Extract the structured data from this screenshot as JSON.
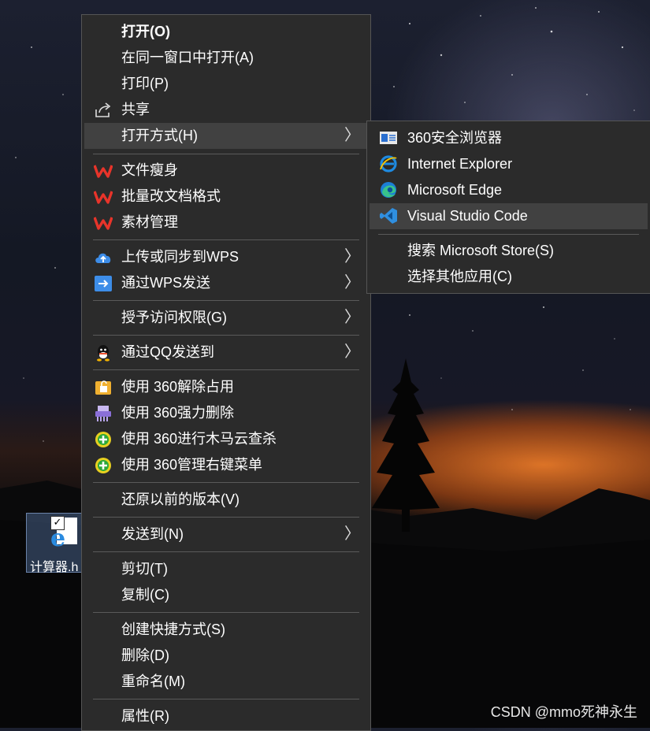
{
  "desktop": {
    "icon_label": "计算器.h",
    "icon_name": "html-file-icon"
  },
  "main_menu": {
    "items": [
      {
        "label": "打开(O)",
        "icon": "none"
      },
      {
        "label": "在同一窗口中打开(A)",
        "icon": "none"
      },
      {
        "label": "打印(P)",
        "icon": "none"
      },
      {
        "label": "共享",
        "icon": "share-icon"
      },
      {
        "label": "打开方式(H)",
        "icon": "none",
        "submenu": true
      },
      {
        "label": "文件瘦身",
        "icon": "wps-icon"
      },
      {
        "label": "批量改文档格式",
        "icon": "wps-icon"
      },
      {
        "label": "素材管理",
        "icon": "wps-icon"
      },
      {
        "label": "上传或同步到WPS",
        "icon": "cloud-upload-icon",
        "submenu": true
      },
      {
        "label": "通过WPS发送",
        "icon": "wps-send-icon",
        "submenu": true
      },
      {
        "label": "授予访问权限(G)",
        "icon": "none",
        "submenu": true
      },
      {
        "label": "通过QQ发送到",
        "icon": "qq-icon",
        "submenu": true
      },
      {
        "label": "使用 360解除占用",
        "icon": "360-unlock-icon"
      },
      {
        "label": "使用 360强力删除",
        "icon": "360-shred-icon"
      },
      {
        "label": "使用 360进行木马云查杀",
        "icon": "360-scan-icon"
      },
      {
        "label": "使用 360管理右键菜单",
        "icon": "360-menu-icon"
      },
      {
        "label": "还原以前的版本(V)",
        "icon": "none"
      },
      {
        "label": "发送到(N)",
        "icon": "none",
        "submenu": true
      },
      {
        "label": "剪切(T)",
        "icon": "none"
      },
      {
        "label": "复制(C)",
        "icon": "none"
      },
      {
        "label": "创建快捷方式(S)",
        "icon": "none"
      },
      {
        "label": "删除(D)",
        "icon": "none"
      },
      {
        "label": "重命名(M)",
        "icon": "none"
      },
      {
        "label": "属性(R)",
        "icon": "none"
      }
    ]
  },
  "sub_menu": {
    "items": [
      {
        "label": "360安全浏览器",
        "icon": "360-browser-icon"
      },
      {
        "label": "Internet Explorer",
        "icon": "internet-explorer-icon"
      },
      {
        "label": "Microsoft Edge",
        "icon": "edge-icon"
      },
      {
        "label": "Visual Studio Code",
        "icon": "vscode-icon"
      },
      {
        "label": "搜索 Microsoft Store(S)",
        "icon": "none"
      },
      {
        "label": "选择其他应用(C)",
        "icon": "none"
      }
    ]
  },
  "watermark": "CSDN @mmo死神永生",
  "colors": {
    "menu_bg": "#2b2b2b",
    "menu_highlight": "#414141",
    "wps_red": "#e8342a",
    "vscode_blue": "#2f8fe0"
  }
}
